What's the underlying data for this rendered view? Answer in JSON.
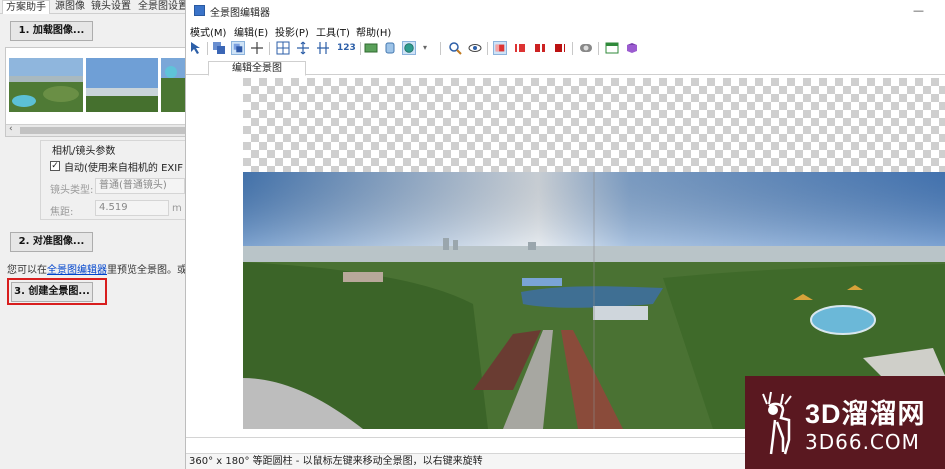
{
  "assistant": {
    "tabs": [
      "方案助手",
      "源图像",
      "镜头设置",
      "全景图设置"
    ],
    "load_images_button": "1. 加载图像...",
    "camera_group_title": "相机/镜头参数",
    "exif_checkbox_label": "自动(使用来自相机的 EXIF 数",
    "exif_checked": true,
    "lens_type_label": "镜头类型:",
    "lens_type_value": "普通(普通镜头)",
    "focal_length_label": "焦距:",
    "focal_length_value": "4.519",
    "focal_unit_partial": "m",
    "align_button": "2. 对准图像...",
    "hint_prefix": "您可以在",
    "hint_link": "全景图编辑器",
    "hint_suffix": "里预览全景图。或",
    "create_button": "3. 创建全景图..."
  },
  "editor": {
    "title": "全景图编辑器",
    "minimize_glyph": "—",
    "menus": [
      "模式(M)",
      "编辑(E)",
      "投影(P)",
      "工具(T)",
      "帮助(H)"
    ],
    "toolbar_numeric_label": "123",
    "view_tab": "编辑全景图",
    "status_text": "360° x 180° 等距圆柱 - 以鼠标左键来移动全景图，以右键来旋转"
  },
  "watermark": {
    "line1": "3D溜溜网",
    "line2": "3D66.COM"
  },
  "colors": {
    "highlight_red": "#d81e1e",
    "link_blue": "#0044cc",
    "watermark_bg": "#5a1820",
    "sky_top": "#5e8fcf",
    "grass": "#3f6a2a"
  }
}
